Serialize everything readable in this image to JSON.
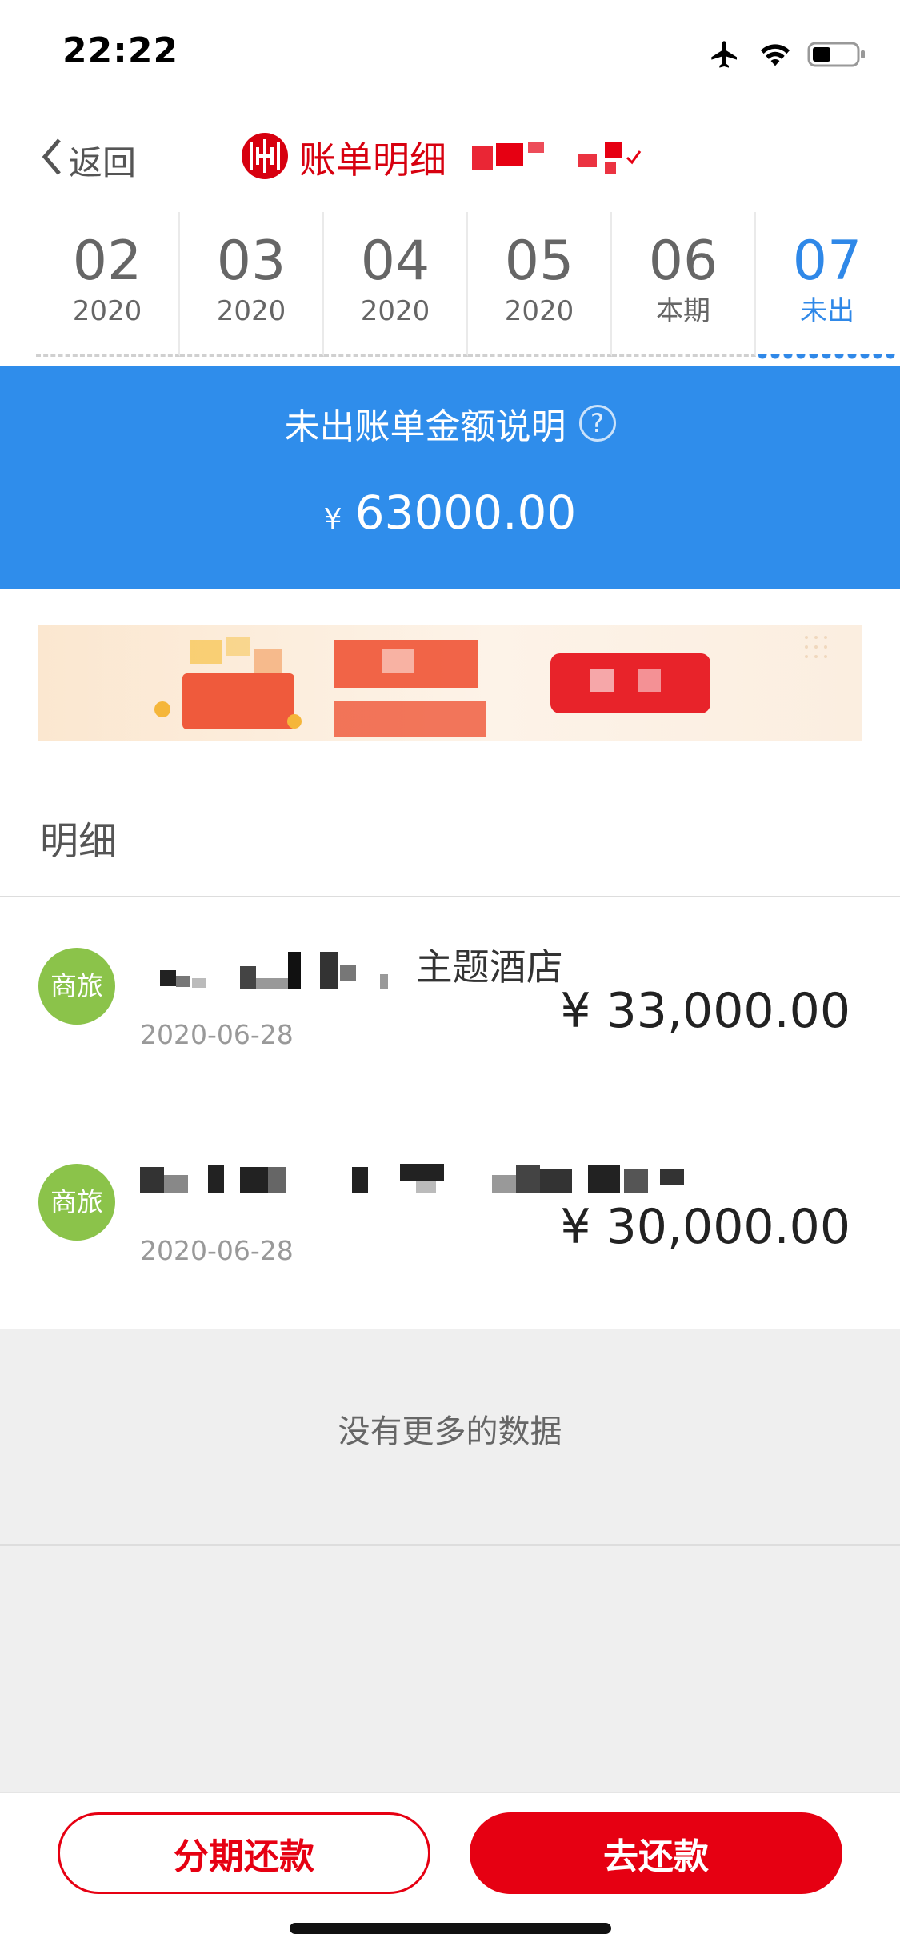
{
  "status_bar": {
    "time": "22:22",
    "icons": [
      "airplane-icon",
      "wifi-icon",
      "battery-icon"
    ]
  },
  "nav": {
    "back_label": "返回",
    "title": "账单明细",
    "logo_icon": "citic-bank-logo"
  },
  "months": [
    {
      "month": "02",
      "sub": "2020",
      "active": false
    },
    {
      "month": "03",
      "sub": "2020",
      "active": false
    },
    {
      "month": "04",
      "sub": "2020",
      "active": false
    },
    {
      "month": "05",
      "sub": "2020",
      "active": false
    },
    {
      "month": "06",
      "sub": "本期",
      "active": false
    },
    {
      "month": "07",
      "sub": "未出",
      "active": true
    }
  ],
  "summary": {
    "label": "未出账单金额说明",
    "help_icon": "?",
    "currency": "¥",
    "amount": "63000.00"
  },
  "section_title": "明细",
  "transactions": [
    {
      "badge": "商旅",
      "merchant": "主题酒店",
      "date": "2020-06-28",
      "amount": "¥ 33,000.00"
    },
    {
      "badge": "商旅",
      "merchant": "",
      "date": "2020-06-28",
      "amount": "¥ 30,000.00"
    }
  ],
  "footer_note": "没有更多的数据",
  "buttons": {
    "installment": "分期还款",
    "repay": "去还款"
  },
  "colors": {
    "brand_red": "#e60012",
    "accent_blue": "#2f8deb",
    "badge_green": "#8bc34a",
    "active_tab": "#2f88e8"
  }
}
